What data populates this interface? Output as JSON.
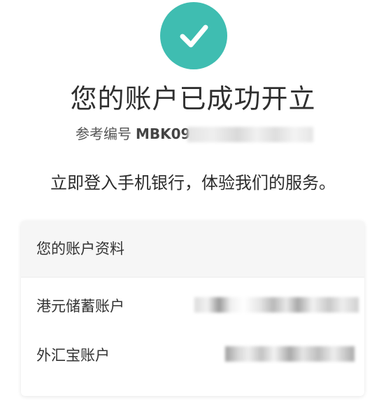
{
  "status": {
    "icon": "checkmark-icon",
    "icon_color": "#3fbdb1",
    "title": "您的账户已成功开立"
  },
  "reference": {
    "label": "参考编号",
    "number_visible": "MBK09"
  },
  "message": "立即登入手机银行，体验我们的服务。",
  "account_card": {
    "header": "您的账户资料",
    "accounts": [
      {
        "name": "港元储蓄账户"
      },
      {
        "name": "外汇宝账户"
      }
    ]
  }
}
